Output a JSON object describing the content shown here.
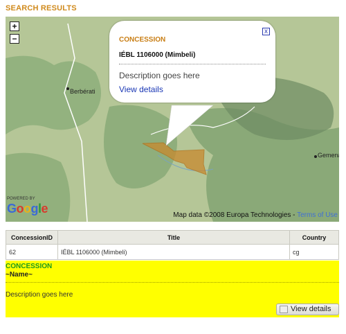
{
  "page": {
    "heading": "SEARCH RESULTS"
  },
  "map": {
    "zoom_in": "+",
    "zoom_out": "−",
    "cities": [
      "Berbérati",
      "Gemena"
    ],
    "popup": {
      "title": "CONCESSION",
      "name": "IÉBL 1106000 (Mimbeli)",
      "description": "Description goes here",
      "link": "View details",
      "close": "x"
    },
    "powered_by": "POWERED BY",
    "attribution": "Map data ©2008 Europa Technologies - ",
    "terms": "Terms of Use",
    "colors": {
      "concession_fill": "#c8892e",
      "land": "#b9c99a",
      "forest": "#8fae7c"
    }
  },
  "table": {
    "columns": [
      "ConcessionID",
      "Title",
      "Country"
    ],
    "rows": [
      [
        "62",
        "IÉBL 1106000 (Mimbeli)",
        "cg"
      ]
    ]
  },
  "detail": {
    "title": "CONCESSION",
    "name": "~Name~",
    "description": "Description goes here",
    "button": "View details"
  }
}
